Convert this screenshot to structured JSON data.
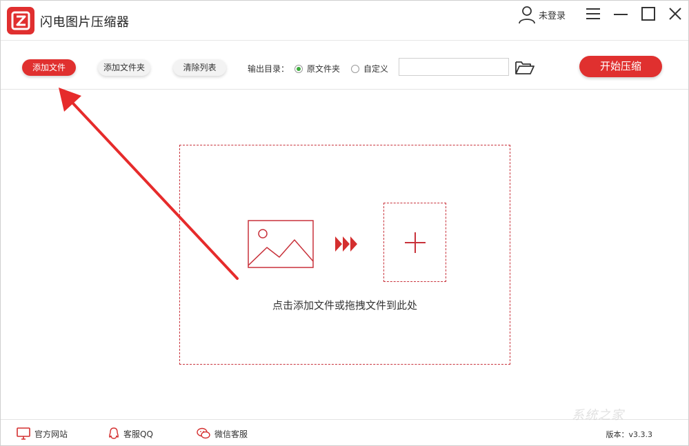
{
  "app": {
    "title": "闪电图片压缩器"
  },
  "titlebar": {
    "user_label": "未登录",
    "icons": [
      "user-icon",
      "menu-icon",
      "minimize-icon",
      "maximize-icon",
      "close-icon"
    ]
  },
  "toolbar": {
    "add_file": "添加文件",
    "add_folder": "添加文件夹",
    "clear_list": "清除列表",
    "output_label": "输出目录：",
    "radio_original": "原文件夹",
    "radio_custom": "自定义",
    "selected_option": "原文件夹",
    "path_value": "",
    "start_button": "开始压缩"
  },
  "dropzone": {
    "hint": "点击添加文件或拖拽文件到此处"
  },
  "footer": {
    "website": "官方网站",
    "qq": "客服QQ",
    "wechat": "微信客服",
    "version": "版本：v3.3.3"
  },
  "watermark": "系统之家",
  "colors": {
    "accent": "#e0302f",
    "radio_selected": "#3cab3c"
  }
}
